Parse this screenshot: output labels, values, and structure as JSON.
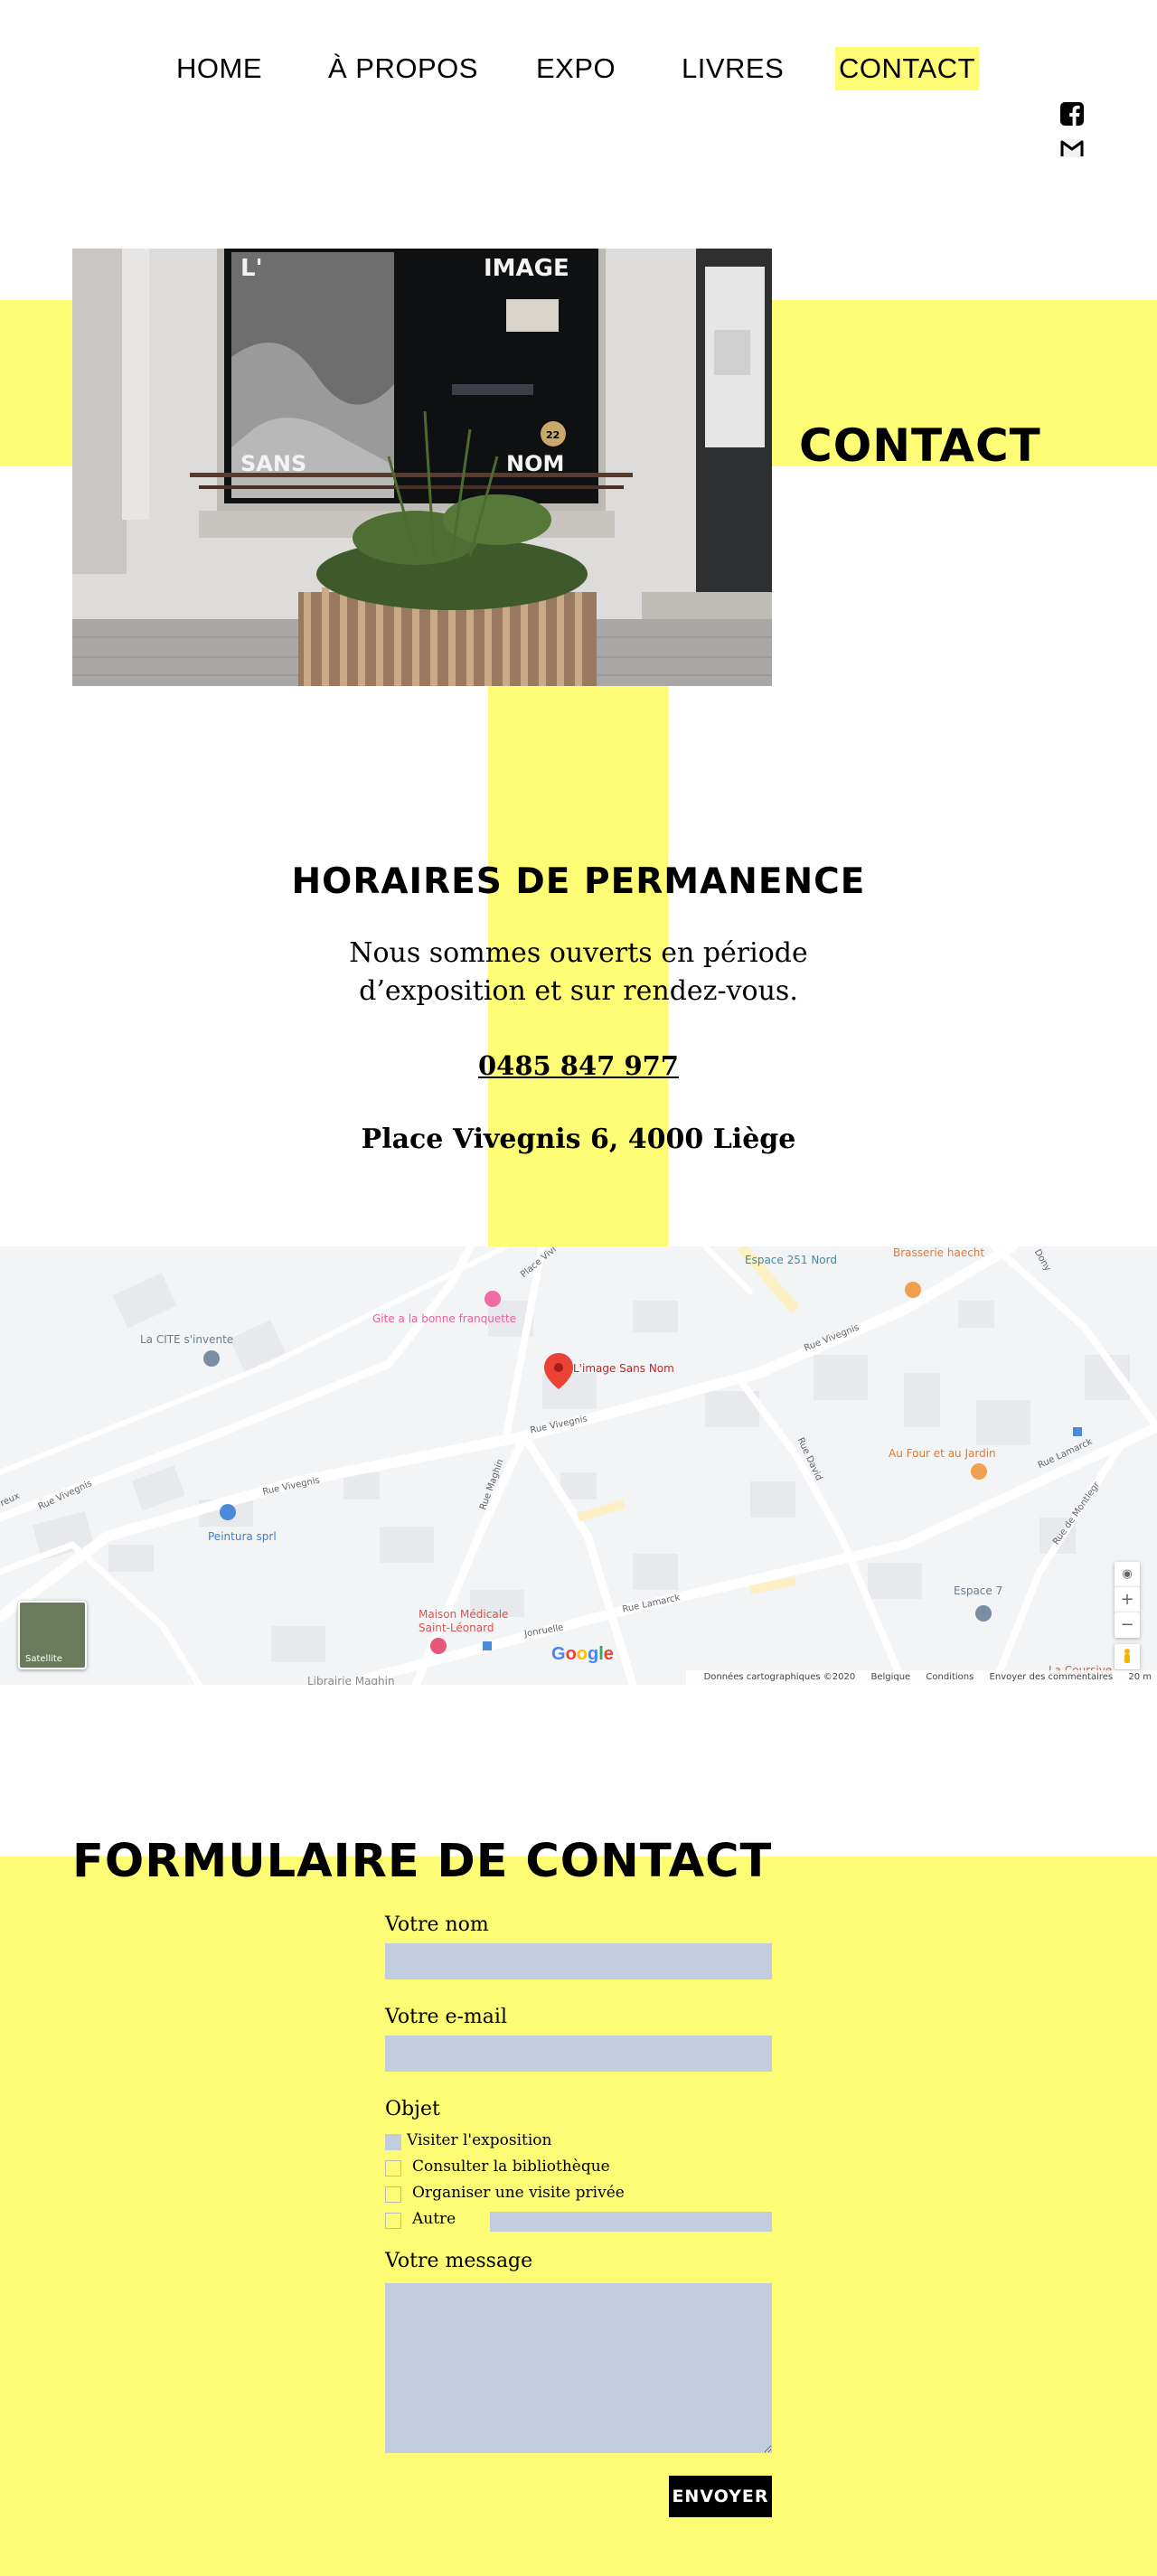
{
  "nav": {
    "items": [
      {
        "label": "HOME"
      },
      {
        "label": "À PROPOS"
      },
      {
        "label": "EXPO"
      },
      {
        "label": "LIVRES"
      },
      {
        "label": "CONTACT",
        "active": true
      }
    ]
  },
  "social": {
    "facebook_icon": "facebook-icon",
    "gmail_icon": "gmail-icon"
  },
  "hero": {
    "title": "CONTACT",
    "image_text": {
      "top_left": "L'",
      "top_right": "IMAGE",
      "bottom_left": "SANS",
      "bottom_right": "NOM",
      "number": "22"
    }
  },
  "hours": {
    "title": "HORAIRES DE PERMANENCE",
    "description": "Nous sommes ouverts en période d’exposition et sur rendez-vous.",
    "phone": "0485 847 977",
    "address": "Place Vivegnis 6, 4000 Liège"
  },
  "map": {
    "places": {
      "main": "L'image Sans Nom",
      "gite": "Gite a la bonne franquette",
      "cite": "La CITE s'invente",
      "peintura": "Peintura sprl",
      "maison1": "Maison Médicale",
      "maison2": "Saint-Léonard",
      "espace251": "Espace 251 Nord",
      "brasserie": "Brasserie haecht",
      "four": "Au Four et au Jardin",
      "espace7": "Espace 7",
      "coursive": "La Coursive",
      "librairie": "Librairie Maghin"
    },
    "streets": {
      "vivegnis1": "Rue Vivegnis",
      "vivegnis2": "Rue Vivegnis",
      "vivegnis3": "Rue Vivegnis",
      "vivegnis4": "Rue Vivegnis",
      "maghin": "Rue Maghin",
      "david": "Rue David",
      "lamarck1": "Rue Lamarck",
      "lamarck2": "Rue Lamarck",
      "montlegr": "Rue de Montlegr",
      "jonruelle": "Jonruelle",
      "placevi": "Place Vivi",
      "dony": "Dony",
      "reux": "reux"
    },
    "google": "Google",
    "satellite": "Satellite",
    "footer": {
      "data": "Données cartographiques ©2020",
      "country": "Belgique",
      "terms": "Conditions",
      "feedback": "Envoyer des commentaires",
      "scale": "20 m"
    },
    "controls": {
      "locate": "◉",
      "zoom_in": "+",
      "zoom_out": "−"
    }
  },
  "form": {
    "title": "FORMULAIRE DE CONTACT",
    "name_label": "Votre nom",
    "email_label": "Votre e-mail",
    "subject_label": "Objet",
    "options": [
      {
        "label": "Visiter l'exposition",
        "checked": true
      },
      {
        "label": "Consulter la bibliothèque",
        "checked": false
      },
      {
        "label": "Organiser une visite privée",
        "checked": false
      },
      {
        "label": "Autre",
        "checked": false
      }
    ],
    "message_label": "Votre message",
    "submit": "ENVOYER"
  },
  "colors": {
    "accent_yellow": "#fdfc74",
    "field_blue": "#c2cde0",
    "button_black": "#000000",
    "pin_red": "#ea4335"
  }
}
